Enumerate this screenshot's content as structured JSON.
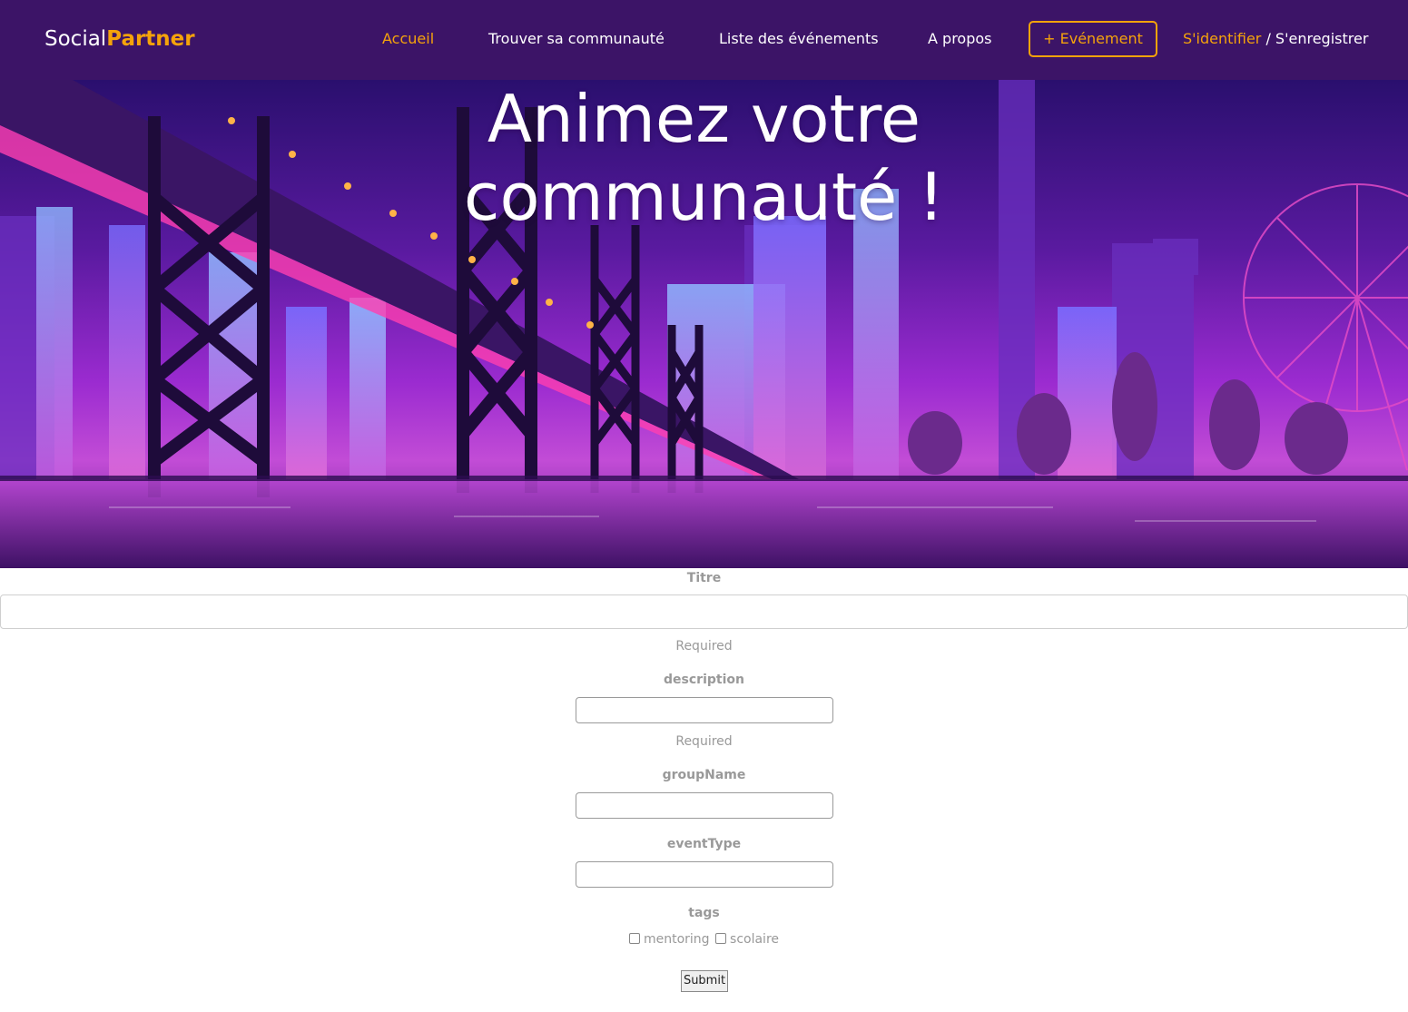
{
  "navbar": {
    "brand_part1": "Social",
    "brand_part2": "Partner",
    "links": [
      "Accueil",
      "Trouver sa communauté",
      "Liste des événements",
      "A propos"
    ],
    "event_button": "+ Evénement",
    "login": "S'identifier",
    "separator": " / ",
    "register": "S'enregistrer"
  },
  "hero": {
    "title_line1": "Animez votre",
    "title_line2": "communauté !"
  },
  "form": {
    "titre_label": "Titre",
    "titre_required": "Required",
    "description_label": "description",
    "description_required": "Required",
    "groupname_label": "groupName",
    "eventtype_label": "eventType",
    "tags_label": "tags",
    "tag_options": [
      "mentoring",
      "scolaire"
    ],
    "submit_label": "Submit"
  },
  "colors": {
    "navbar_bg": "#3c1467",
    "accent": "#f5a30b",
    "label": "#999999"
  }
}
